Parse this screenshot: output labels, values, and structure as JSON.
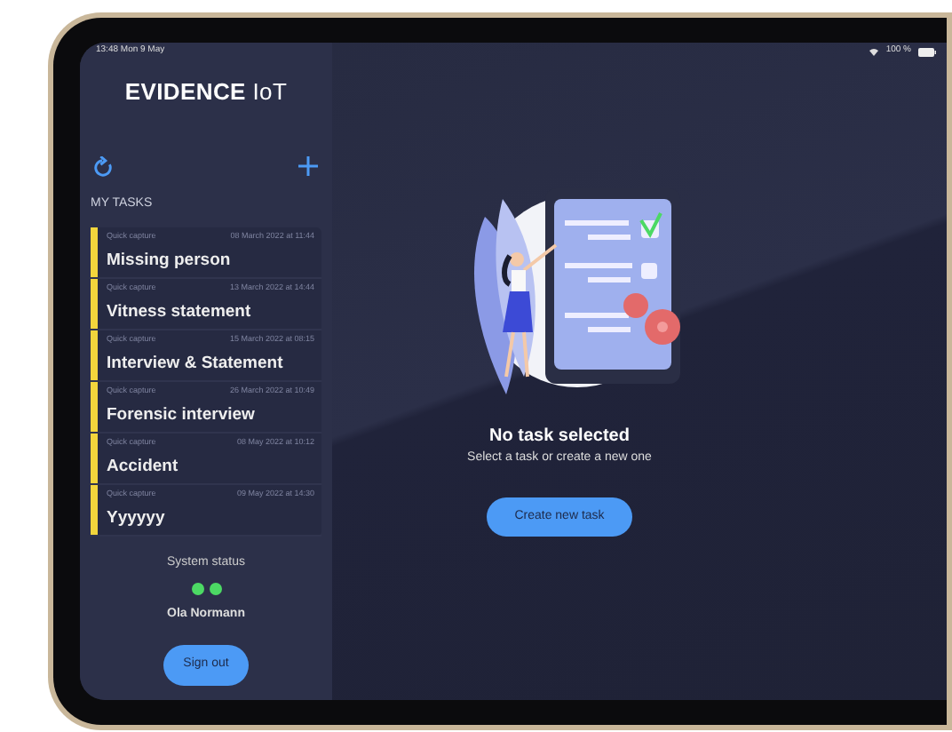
{
  "status_bar": {
    "time": "13:48",
    "date": "Mon 9 May",
    "battery": "100 %"
  },
  "sidebar": {
    "logo": {
      "bold": "EVIDENCE",
      "light": "IoT"
    },
    "section_title": "MY TASKS",
    "tasks": [
      {
        "type": "Quick capture",
        "date": "08 March 2022 at 11:44",
        "title": "Missing person",
        "selected": false
      },
      {
        "type": "Quick capture",
        "date": "13 March 2022 at 14:44",
        "title": "Vitness statement",
        "selected": false
      },
      {
        "type": "Quick capture",
        "date": "15 March 2022 at 08:15",
        "title": "Interview & Statement",
        "selected": false
      },
      {
        "type": "Quick capture",
        "date": "26 March 2022 at 10:49",
        "title": "Forensic interview",
        "selected": false
      },
      {
        "type": "Quick capture",
        "date": "08 May 2022 at 10:12",
        "title": "Accident",
        "selected": false
      },
      {
        "type": "Quick capture",
        "date": "09 May 2022 at 14:30",
        "title": "Yyyyyy",
        "selected": false
      }
    ],
    "system_status": {
      "label": "System status",
      "indicators": [
        {
          "color": "#4cd964"
        },
        {
          "color": "#4cd964"
        }
      ]
    },
    "user_name": "Ola Normann",
    "sign_out_button": "Sign out"
  },
  "main": {
    "empty_title": "No task selected",
    "empty_subtitle": "Select a task or create a new one",
    "create_button": "Create new task"
  }
}
